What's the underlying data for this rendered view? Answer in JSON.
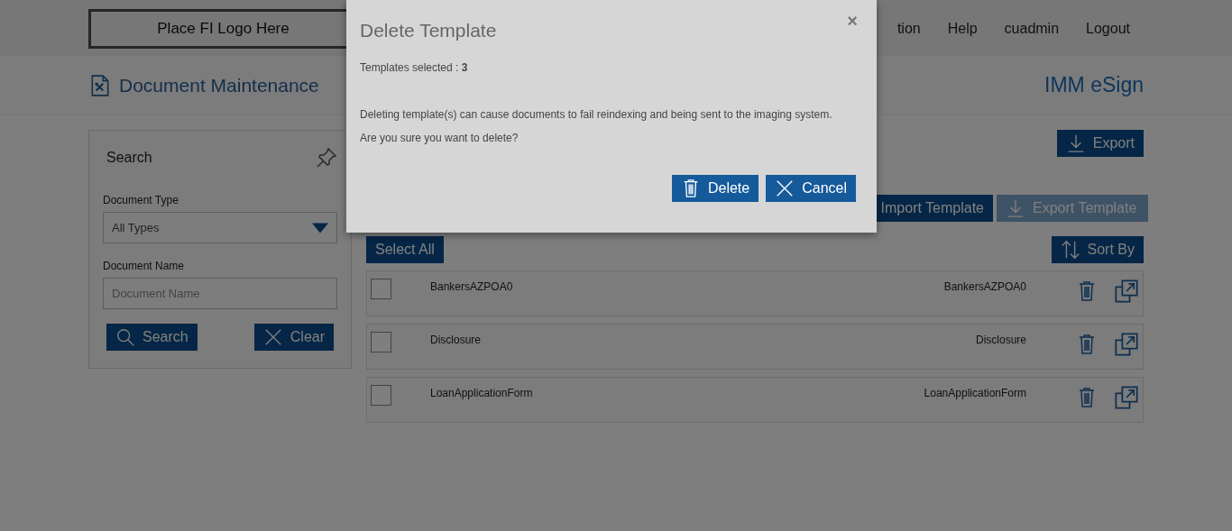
{
  "header": {
    "logo": "Place FI Logo Here",
    "nav": [
      {
        "label": "tion"
      },
      {
        "label": "Help"
      },
      {
        "label": "cuadmin"
      },
      {
        "label": "Logout"
      }
    ]
  },
  "page": {
    "title": "Document Maintenance",
    "brand": "IMM eSign"
  },
  "search_panel": {
    "title": "Search",
    "fields": [
      {
        "label": "Document Type",
        "kind": "select",
        "value": "All Types"
      },
      {
        "label": "Document Name",
        "kind": "text",
        "placeholder": "Document Name"
      }
    ],
    "buttons": [
      {
        "label": "Search"
      },
      {
        "label": "Clear"
      }
    ]
  },
  "export_button": {
    "label": "Export"
  },
  "toolbar": [
    {
      "label": "Import Template",
      "disabled": false
    },
    {
      "label": "Export Template",
      "disabled": true
    }
  ],
  "select_all": {
    "label": "Select All"
  },
  "sort_by": {
    "label": "Sort By"
  },
  "rows": [
    {
      "name": "BankersAZPOA0",
      "title": "BankersAZPOA0",
      "checked": false
    },
    {
      "name": "Disclosure",
      "title": "Disclosure",
      "checked": false
    },
    {
      "name": "LoanApplicationForm",
      "title": "LoanApplicationForm",
      "checked": false
    }
  ],
  "modal": {
    "title": "Delete Template",
    "close": "×",
    "selected_text": "Templates selected : **3**",
    "message": "Deleting template(s) can cause documents to fail reindexing and being sent to the imaging system.",
    "question": "Are you sure you want to delete?",
    "buttons": [
      {
        "label": "Delete"
      },
      {
        "label": "Cancel"
      }
    ]
  }
}
